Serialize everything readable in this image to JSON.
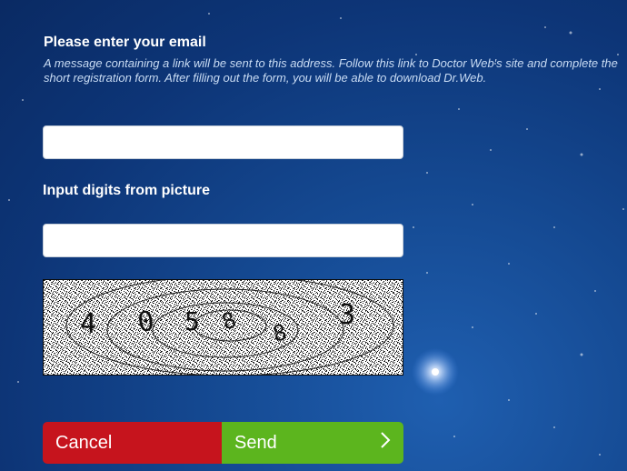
{
  "form": {
    "email_title": "Please enter your email",
    "email_description": "A message containing a link will be sent to this address. Follow this link to Doctor Web's site and complete the short registration form. After filling out the form, you will be able to download Dr.Web.",
    "email_value": "",
    "captcha_label": "Input digits from picture",
    "captcha_value": "",
    "captcha_digits": [
      "4",
      "0",
      "5",
      "8",
      "8",
      "3"
    ]
  },
  "buttons": {
    "cancel_label": "Cancel",
    "send_label": "Send",
    "send_icon": "chevron-right-icon"
  },
  "colors": {
    "background": "#0d3577",
    "cancel": "#c6141d",
    "send": "#5cb51e"
  }
}
